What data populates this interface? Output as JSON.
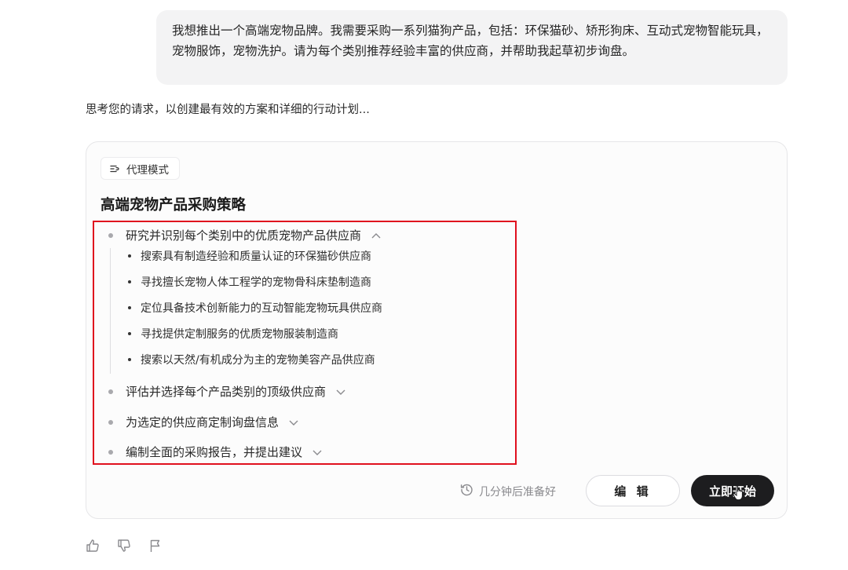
{
  "user_message": "我想推出一个高端宠物品牌。我需要采购一系列猫狗产品，包括：环保猫砂、矫形狗床、互动式宠物智能玩具，宠物服饰，宠物洗护。请为每个类别推荐经验丰富的供应商，并帮助我起草初步询盘。",
  "thinking_text": "思考您的请求，以创建最有效的方案和详细的行动计划...",
  "plan": {
    "mode_label": "代理模式",
    "title": "高端宠物产品采购策略",
    "steps": [
      {
        "label": "研究并识别每个类别中的优质宠物产品供应商",
        "expanded": true,
        "substeps": [
          "搜索具有制造经验和质量认证的环保猫砂供应商",
          "寻找擅长宠物人体工程学的宠物骨科床垫制造商",
          "定位具备技术创新能力的互动智能宠物玩具供应商",
          "寻找提供定制服务的优质宠物服装制造商",
          "搜索以天然/有机成分为主的宠物美容产品供应商"
        ]
      },
      {
        "label": "评估并选择每个产品类别的顶级供应商",
        "expanded": false
      },
      {
        "label": "为选定的供应商定制询盘信息",
        "expanded": false
      },
      {
        "label": "编制全面的采购报告，并提出建议",
        "expanded": false
      }
    ],
    "ready_text": "几分钟后准备好",
    "edit_label": "编 辑",
    "start_label": "立即开始"
  },
  "icons": {
    "mode": "agent-mode-icon",
    "clock": "history-clock-icon",
    "thumbs_up": "thumbs-up-icon",
    "thumbs_down": "thumbs-down-icon",
    "flag": "flag-icon"
  },
  "colors": {
    "highlight_border": "#e0101e",
    "primary_button": "#1d1d1f"
  }
}
